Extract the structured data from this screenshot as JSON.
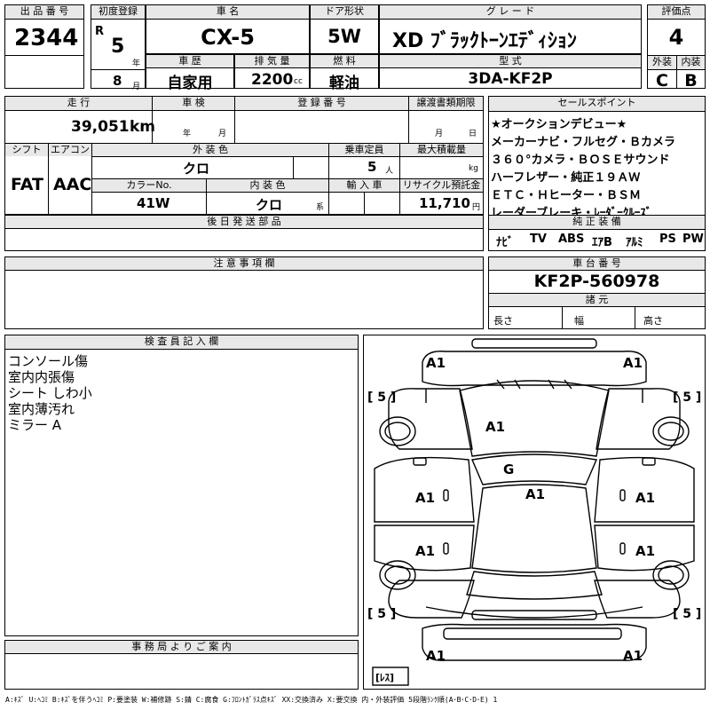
{
  "top": {
    "lot_label": "出 品 番 号",
    "lot_number": "2344",
    "first_reg_label": "初度登録",
    "era": "R",
    "year": "5",
    "year_unit": "年",
    "month": "8",
    "month_unit": "月",
    "car_name_label": "車 名",
    "car_name": "CX-5",
    "door_label": "ドア形状",
    "door": "5W",
    "grade_label": "グ レ ー ド",
    "grade": "XD ﾌﾞﾗｯｸﾄｰﾝｴﾃﾞｨｼｮﾝ",
    "score_label": "評価点",
    "score": "4",
    "history_label": "車 歴",
    "history": "自家用",
    "displacement_label": "排 気 量",
    "displacement": "2200",
    "displacement_unit": "cc",
    "fuel_label": "燃 料",
    "fuel": "軽油",
    "model_label": "型 式",
    "model": "3DA-KF2P",
    "exterior_label": "外装",
    "exterior": "C",
    "interior_label": "内装",
    "interior": "B"
  },
  "mid": {
    "mileage_label": "走 行",
    "mileage": "39,051",
    "mileage_unit": "km",
    "inspection_label": "車 検",
    "insp_year_unit": "年",
    "insp_month_unit": "月",
    "reg_no_label": "登 録 番 号",
    "transfer_label": "譲渡書類期限",
    "transfer_month_unit": "月",
    "transfer_day_unit": "日",
    "shift_label": "シフト",
    "shift": "FAT",
    "ac_label": "エアコン",
    "ac": "AAC",
    "ext_color_label": "外 装 色",
    "ext_color": "クロ",
    "capacity_label": "乗車定員",
    "capacity": "5",
    "capacity_unit": "人",
    "load_label": "最大積載量",
    "load_unit": "kg",
    "color_no_label": "カラーNo.",
    "color_no": "41W",
    "int_color_label": "内 装 色",
    "int_color": "クロ",
    "int_color_unit": "系",
    "import_label": "輸 入 車",
    "recycle_label": "リサイクル預託金",
    "recycle": "11,710",
    "recycle_unit": "円",
    "later_parts_label": "後 日 発 送 部 品"
  },
  "sales": {
    "label": "セールスポイント",
    "lines": [
      "★オークションデビュー★",
      "メーカーナビ・フルセグ・Ｂカメラ",
      "３６０°カメラ・ＢＯＳＥサウンド",
      "ハーフレザー・純正１９ＡＷ",
      "ＥＴＣ・Ｈヒーター・ＢＳＭ",
      "レーダーブレーキ・ﾚｰﾀﾞｰｸﾙｰｽﾞ"
    ],
    "equip_label": "純 正 装 備",
    "equip": [
      "ﾅﾋﾞ",
      "TV",
      "ABS",
      "ｴｱB",
      "ｱﾙﾐ",
      "PS",
      "PW"
    ]
  },
  "notes": {
    "label": "注 意 事 項 欄"
  },
  "chassis": {
    "label": "車 台 番 号",
    "value": "KF2P-560978",
    "spec_label": "諸 元",
    "length_label": "長さ",
    "width_label": "幅",
    "height_label": "高さ"
  },
  "inspector": {
    "label": "検 査 員 記 入 欄",
    "lines": [
      "コンソール傷",
      "室内内張傷",
      "シート しわ小",
      "室内薄汚れ",
      "ミラー A"
    ]
  },
  "office": {
    "label": "事 務 局 よ り ご 案 内"
  },
  "diagram": {
    "marks": {
      "a1_fl": "A1",
      "a1_fr": "A1",
      "tire_fl": "[ 5 ]",
      "tire_fr": "[ 5 ]",
      "a1_hood": "A1",
      "g_glass": "G",
      "a1_roof": "A1",
      "a1_door_fl": "A1",
      "a1_door_fr": "A1",
      "a1_door_rl": "A1",
      "a1_door_rr": "A1",
      "tire_rl": "[ 5 ]",
      "tire_rr": "[ 5 ]",
      "a1_rl": "A1",
      "a1_rr": "A1",
      "spare": "[ﾚｽ]"
    }
  },
  "legend": "A:ｷｽﾞ U:ﾍｺﾐ B:ｷｽﾞを伴うﾍｺﾐ P:要塗装 W:補修跡 S:錆 C:腐食 G:ﾌﾛﾝﾄｶﾞﾗｽ点ｷｽﾞ XX:交換済み X:要交換 内・外装評価 5段階ﾗﾝｸ順(A･B･C･D･E) 1"
}
